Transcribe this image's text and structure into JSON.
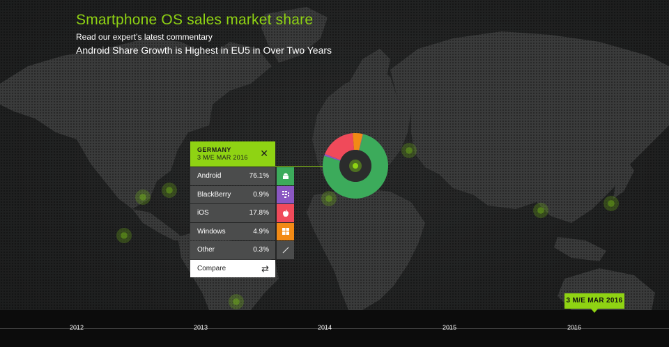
{
  "header": {
    "title": "Smartphone OS sales market share",
    "commentary_link": "Read our expert’s latest commentary",
    "headline": "Android Share Growth is Highest in EU5 in Over Two Years"
  },
  "panel": {
    "country": "GERMANY",
    "period": "3 M/E MAR 2016",
    "close_icon": "close-icon",
    "rows": [
      {
        "name": "Android",
        "value": "76.1%",
        "share": 76.1,
        "color": "#3cab5b",
        "icon": "android-icon"
      },
      {
        "name": "BlackBerry",
        "value": "0.9%",
        "share": 0.9,
        "color": "#8a57c2",
        "icon": "blackberry-icon"
      },
      {
        "name": "iOS",
        "value": "17.8%",
        "share": 17.8,
        "color": "#f04a5a",
        "icon": "apple-icon"
      },
      {
        "name": "Windows",
        "value": "4.9%",
        "share": 4.9,
        "color": "#f28a15",
        "icon": "windows-icon"
      },
      {
        "name": "Other",
        "value": "0.3%",
        "share": 0.3,
        "color": "#8a8a8a",
        "icon": "other-slash-icon"
      }
    ],
    "compare_label": "Compare",
    "compare_icon": "swap-arrows-icon"
  },
  "timeline": {
    "years": [
      "2012",
      "2013",
      "2014",
      "2015",
      "2016"
    ],
    "selected_label": "3 M/E MAR 2016"
  },
  "colors": {
    "accent": "#8fd313",
    "background": "#1e1f1f"
  }
}
